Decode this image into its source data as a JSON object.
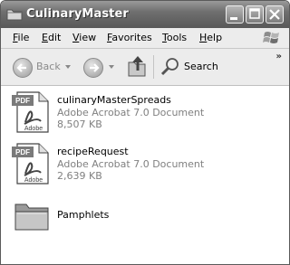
{
  "window": {
    "title": "CulinaryMaster"
  },
  "menu": [
    "File",
    "Edit",
    "View",
    "Favorites",
    "Tools",
    "Help"
  ],
  "toolbar": {
    "back_label": "Back",
    "search_label": "Search"
  },
  "files": [
    {
      "name": "culinaryMasterSpreads",
      "type": "Adobe Acrobat 7.0 Document",
      "size": "8,507 KB",
      "icon": "pdf-icon"
    },
    {
      "name": "recipeRequest",
      "type": "Adobe Acrobat 7.0 Document",
      "size": "2,639 KB",
      "icon": "pdf-icon"
    },
    {
      "name": "Pamphlets",
      "icon": "folder-icon"
    }
  ],
  "icon_labels": {
    "pdf": "PDF",
    "adobe": "Adobe"
  }
}
